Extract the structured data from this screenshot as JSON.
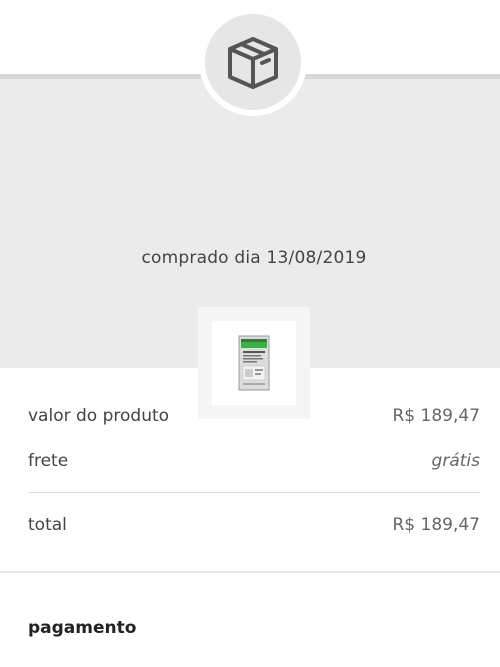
{
  "order": {
    "icon": "box-icon",
    "purchase_date": "comprado dia 13/08/2019",
    "product_image": "hard-drive-product-image"
  },
  "summary": {
    "product_label": "valor do produto",
    "product_value": "R$ 189,47",
    "shipping_label": "frete",
    "shipping_value": "grátis",
    "total_label": "total",
    "total_value": "R$ 189,47"
  },
  "payment": {
    "title": "pagamento"
  },
  "colors": {
    "header_background": "#ebebeb",
    "divider": "#e0e0e0",
    "text": "#444444",
    "product_label_green": "#3fae49"
  }
}
